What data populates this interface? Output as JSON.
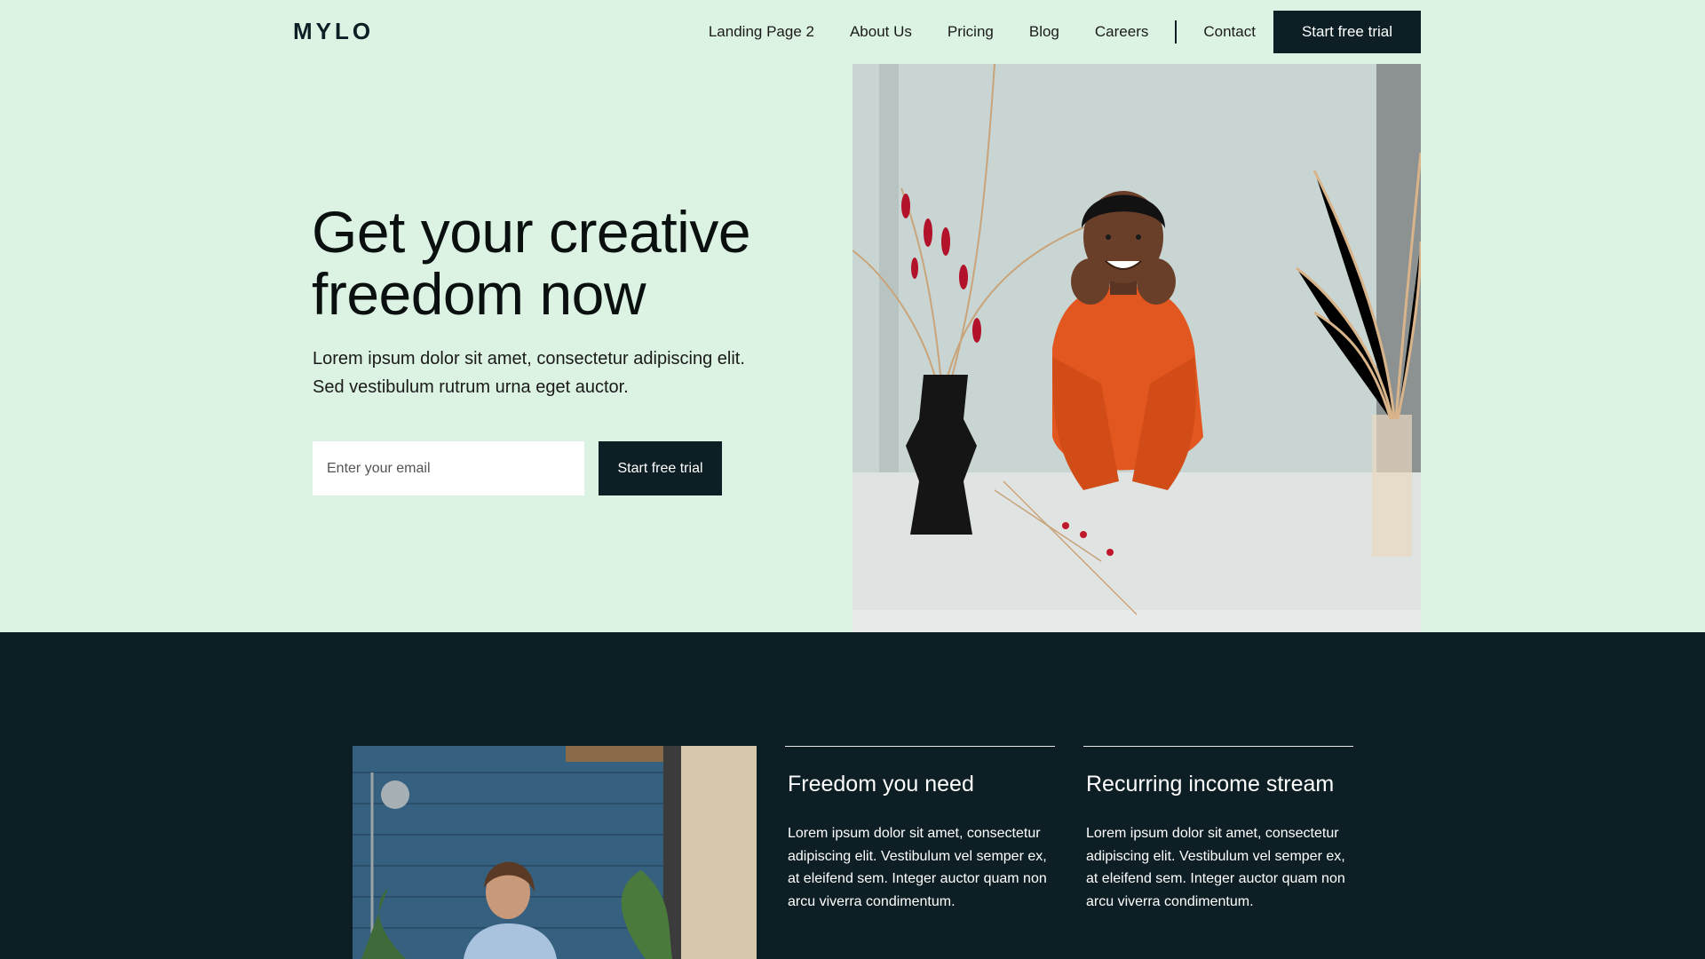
{
  "brand": {
    "logo_text": "MYLO"
  },
  "nav": {
    "items": [
      {
        "label": "Landing Page 2"
      },
      {
        "label": "About Us"
      },
      {
        "label": "Pricing"
      },
      {
        "label": "Blog"
      },
      {
        "label": "Careers"
      }
    ],
    "contact_label": "Contact",
    "cta_label": "Start free trial"
  },
  "hero": {
    "title": "Get your creative freedom now",
    "subtitle": "Lorem ipsum dolor sit amet, consectetur adipiscing elit. Sed vestibulum rutrum urna eget auctor.",
    "email_placeholder": "Enter your email",
    "cta_label": "Start free trial"
  },
  "features": [
    {
      "title": "Freedom you need",
      "body": "Lorem ipsum dolor sit amet, consectetur adipiscing elit. Vestibulum vel semper ex, at eleifend sem. Integer auctor quam non arcu viverra condimentum."
    },
    {
      "title": "Recurring income stream",
      "body": "Lorem ipsum dolor sit amet, consectetur adipiscing elit. Vestibulum vel semper ex, at eleifend sem. Integer auctor quam non arcu viverra condimentum."
    }
  ],
  "colors": {
    "hero_bg": "#dcf3e3",
    "dark": "#0d1f24",
    "accent_orange": "#e2571f"
  }
}
